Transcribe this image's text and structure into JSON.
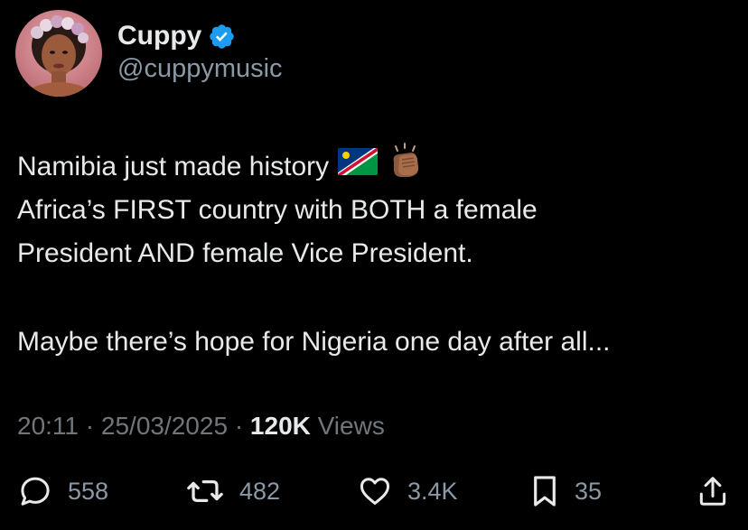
{
  "author": {
    "display_name": "Cuppy",
    "handle": "@cuppymusic",
    "verified": true,
    "avatar": "profile-photo"
  },
  "tweet": {
    "lines": [
      "Namibia just made history",
      "Africa’s FIRST country with BOTH a female",
      "President AND female Vice President.",
      "Maybe there’s hope for Nigeria one day after all..."
    ],
    "emojis": [
      "namibia-flag-emoji",
      "clapping-hands-emoji"
    ]
  },
  "meta": {
    "time": "20:11",
    "separator": "·",
    "date": "25/03/2025",
    "views_count": "120K",
    "views_label": "Views"
  },
  "actions": {
    "replies": "558",
    "reposts": "482",
    "likes": "3.4K",
    "bookmarks": "35"
  },
  "colors": {
    "background": "#000000",
    "text_primary": "#e7e9ea",
    "text_secondary": "#71767b",
    "verified_blue": "#1d9bf0"
  }
}
